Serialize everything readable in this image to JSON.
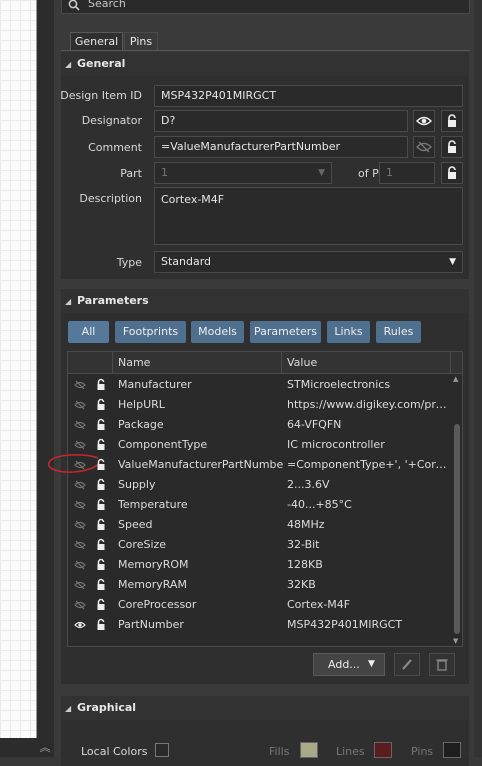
{
  "search": {
    "placeholder": "Search"
  },
  "tabs": [
    {
      "label": "General"
    },
    {
      "label": "Pins"
    }
  ],
  "general": {
    "title": "General",
    "design_item_id_label": "Design Item ID",
    "design_item_id": "MSP432P401MIRGCT",
    "designator_label": "Designator",
    "designator": "D?",
    "comment_label": "Comment",
    "comment": "=ValueManufacturerPartNumber",
    "part_label": "Part",
    "part": "1",
    "of_parts_label": "of Parts",
    "of_parts": "1",
    "description_label": "Description",
    "description": "Cortex-M4F",
    "type_label": "Type",
    "type": "Standard"
  },
  "parameters": {
    "title": "Parameters",
    "filters": [
      {
        "label": "All"
      },
      {
        "label": "Footprints"
      },
      {
        "label": "Models"
      },
      {
        "label": "Parameters"
      },
      {
        "label": "Links"
      },
      {
        "label": "Rules"
      }
    ],
    "columns": {
      "name": "Name",
      "value": "Value"
    },
    "rows": [
      {
        "name": "Manufacturer",
        "value": "STMicroelectronics",
        "visible": false
      },
      {
        "name": "HelpURL",
        "value": "https://www.digikey.com/pro...",
        "visible": false
      },
      {
        "name": "Package",
        "value": "64-VFQFN",
        "visible": false
      },
      {
        "name": "ComponentType",
        "value": "IC microcontroller",
        "visible": false
      },
      {
        "name": "ValueManufacturerPartNumber",
        "value": "=ComponentType+', '+CoreSi...",
        "visible": false
      },
      {
        "name": "Supply",
        "value": "2...3.6V",
        "visible": false
      },
      {
        "name": "Temperature",
        "value": "-40...+85°C",
        "visible": false
      },
      {
        "name": "Speed",
        "value": "48MHz",
        "visible": false
      },
      {
        "name": "CoreSize",
        "value": "32-Bit",
        "visible": false
      },
      {
        "name": "MemoryROM",
        "value": "128KB",
        "visible": false
      },
      {
        "name": "MemoryRAM",
        "value": "32KB",
        "visible": false
      },
      {
        "name": "CoreProcessor",
        "value": "Cortex-M4F",
        "visible": false
      },
      {
        "name": "PartNumber",
        "value": "MSP432P401MIRGCT",
        "visible": true
      }
    ],
    "add_label": "Add..."
  },
  "graphical": {
    "title": "Graphical",
    "local_colors_label": "Local Colors",
    "fills_label": "Fills",
    "lines_label": "Lines",
    "pins_label": "Pins",
    "fills_color": "#a9a98a",
    "lines_color": "#5a1c1c",
    "pins_color": "#1e1e1e"
  },
  "colors": {
    "accent": "#55789b",
    "annotation": "#c0282c"
  }
}
